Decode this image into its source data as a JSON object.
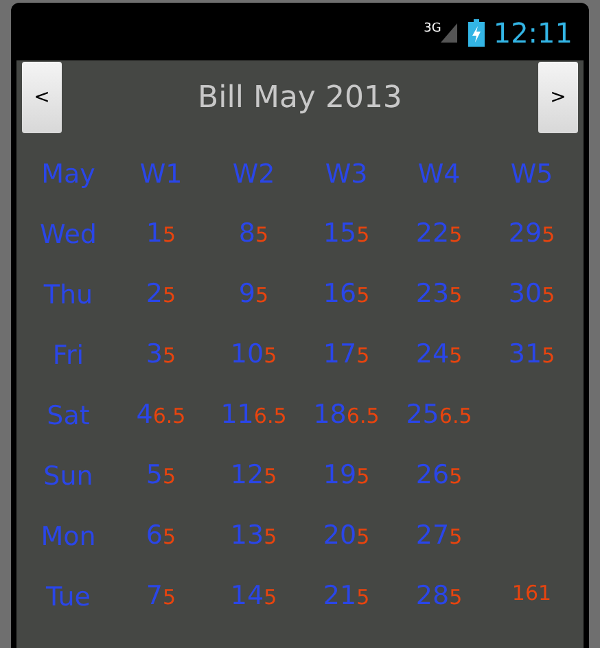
{
  "status_bar": {
    "network": "3G",
    "time": "12:11"
  },
  "header": {
    "prev": "<",
    "title": "Bill May 2013",
    "next": ">"
  },
  "table": {
    "corner": "May",
    "columns": [
      "W1",
      "W2",
      "W3",
      "W4",
      "W5"
    ],
    "rows": [
      {
        "label": "Wed",
        "cells": [
          {
            "day": "1",
            "amount": "5"
          },
          {
            "day": "8",
            "amount": "5"
          },
          {
            "day": "15",
            "amount": "5"
          },
          {
            "day": "22",
            "amount": "5"
          },
          {
            "day": "29",
            "amount": "5"
          }
        ]
      },
      {
        "label": "Thu",
        "cells": [
          {
            "day": "2",
            "amount": "5"
          },
          {
            "day": "9",
            "amount": "5"
          },
          {
            "day": "16",
            "amount": "5"
          },
          {
            "day": "23",
            "amount": "5"
          },
          {
            "day": "30",
            "amount": "5"
          }
        ]
      },
      {
        "label": "Fri",
        "cells": [
          {
            "day": "3",
            "amount": "5"
          },
          {
            "day": "10",
            "amount": "5"
          },
          {
            "day": "17",
            "amount": "5"
          },
          {
            "day": "24",
            "amount": "5"
          },
          {
            "day": "31",
            "amount": "5"
          }
        ]
      },
      {
        "label": "Sat",
        "cells": [
          {
            "day": "4",
            "amount": "6.5"
          },
          {
            "day": "11",
            "amount": "6.5"
          },
          {
            "day": "18",
            "amount": "6.5"
          },
          {
            "day": "25",
            "amount": "6.5"
          },
          {}
        ]
      },
      {
        "label": "Sun",
        "cells": [
          {
            "day": "5",
            "amount": "5"
          },
          {
            "day": "12",
            "amount": "5"
          },
          {
            "day": "19",
            "amount": "5"
          },
          {
            "day": "26",
            "amount": "5"
          },
          {}
        ]
      },
      {
        "label": "Mon",
        "cells": [
          {
            "day": "6",
            "amount": "5"
          },
          {
            "day": "13",
            "amount": "5"
          },
          {
            "day": "20",
            "amount": "5"
          },
          {
            "day": "27",
            "amount": "5"
          },
          {}
        ]
      },
      {
        "label": "Tue",
        "cells": [
          {
            "day": "7",
            "amount": "5"
          },
          {
            "day": "14",
            "amount": "5"
          },
          {
            "day": "21",
            "amount": "5"
          },
          {
            "day": "28",
            "amount": "5"
          },
          {
            "amount": "161"
          }
        ]
      }
    ]
  }
}
